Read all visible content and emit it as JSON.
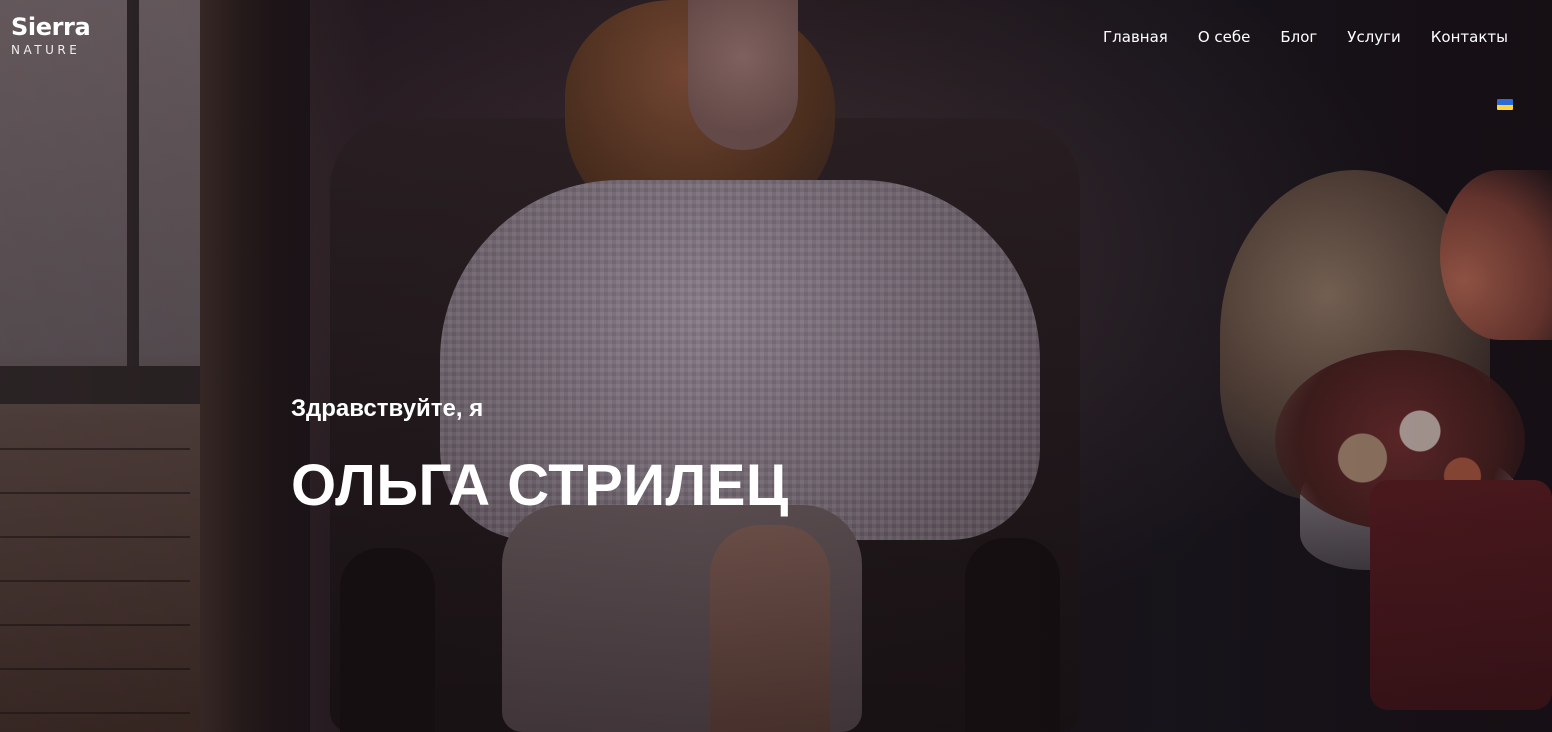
{
  "header": {
    "logo": {
      "primary": "Sierra",
      "secondary": "NATURE"
    },
    "nav_items": [
      {
        "label": "Главная"
      },
      {
        "label": "О себе"
      },
      {
        "label": "Блог"
      },
      {
        "label": "Услуги"
      },
      {
        "label": "Контакты"
      }
    ],
    "language": {
      "icon": "ukraine-flag-icon",
      "colors": {
        "top": "#2f6bd6",
        "bottom": "#ffd633"
      }
    }
  },
  "hero": {
    "greeting": "Здравствуйте, я",
    "name": "ОЛЬГА СТРИЛЕЦ",
    "background_image": "woman-in-armchair-photo"
  },
  "colors": {
    "text": "#ffffff"
  }
}
